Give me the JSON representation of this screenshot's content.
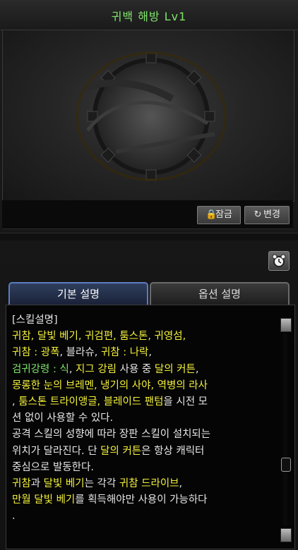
{
  "window": {
    "title": "귀백 해방 Lv1"
  },
  "preview": {
    "logo_icon": "dungeon-fighter-emblem"
  },
  "actions": {
    "lock_label": "잠금",
    "change_label": "변경",
    "lock_icon": "lock-icon",
    "change_icon": "swap-icon"
  },
  "tabs": [
    {
      "label": "기본 설명",
      "active": true
    },
    {
      "label": "옵션 설명",
      "active": false
    }
  ],
  "description": {
    "lines": [
      [
        {
          "t": "[스킬설명]",
          "c": "w"
        }
      ],
      [
        {
          "t": "귀참, 달빛 베기, 귀검편, 툼스톤, 귀영섬,",
          "c": "y"
        }
      ],
      [
        {
          "t": "귀참 : 광폭",
          "c": "y"
        },
        {
          "t": ", 블라슈, ",
          "c": "w"
        },
        {
          "t": "귀참 : 나락",
          "c": "y"
        },
        {
          "t": ",",
          "c": "w"
        }
      ],
      [
        {
          "t": "검귀강령 : 식",
          "c": "g"
        },
        {
          "t": ", ",
          "c": "w"
        },
        {
          "t": "지그 강림",
          "c": "y"
        },
        {
          "t": " 사용 중 ",
          "c": "w"
        },
        {
          "t": "달의 커튼",
          "c": "y"
        },
        {
          "t": ",",
          "c": "w"
        }
      ],
      [
        {
          "t": "몽롱한 눈의 브레멘, 냉기의 사야, 역병의 라사",
          "c": "y"
        }
      ],
      [
        {
          "t": ", ",
          "c": "w"
        },
        {
          "t": "툼스톤 트라이앵글, 블레이드 팬텀",
          "c": "y"
        },
        {
          "t": "을 시전 모",
          "c": "w"
        }
      ],
      [
        {
          "t": "션 없이 사용할 수 있다.",
          "c": "w"
        }
      ],
      [
        {
          "t": "공격 스킬의 성향에 따라 장판 스킬이 설치되는",
          "c": "w"
        }
      ],
      [
        {
          "t": " 위치가 달라진다. 단 ",
          "c": "w"
        },
        {
          "t": "달의 커튼",
          "c": "y"
        },
        {
          "t": "은 항상 캐릭터",
          "c": "w"
        }
      ],
      [
        {
          "t": " 중심으로 발동한다.",
          "c": "w"
        }
      ],
      [
        {
          "t": "귀참",
          "c": "y"
        },
        {
          "t": "과 ",
          "c": "w"
        },
        {
          "t": "달빛 베기",
          "c": "y"
        },
        {
          "t": "는 각각 ",
          "c": "w"
        },
        {
          "t": "귀참 드라이브",
          "c": "y"
        },
        {
          "t": ",",
          "c": "w"
        }
      ],
      [
        {
          "t": "만월 달빛 베기",
          "c": "y"
        },
        {
          "t": "를 획득해야만 사용이 가능하다",
          "c": "w"
        }
      ],
      [
        {
          "t": ".",
          "c": "w"
        }
      ]
    ]
  },
  "colors": {
    "accent_yellow": "#f2f03a",
    "accent_green": "#7fe36a",
    "text": "#e6e6e6"
  }
}
